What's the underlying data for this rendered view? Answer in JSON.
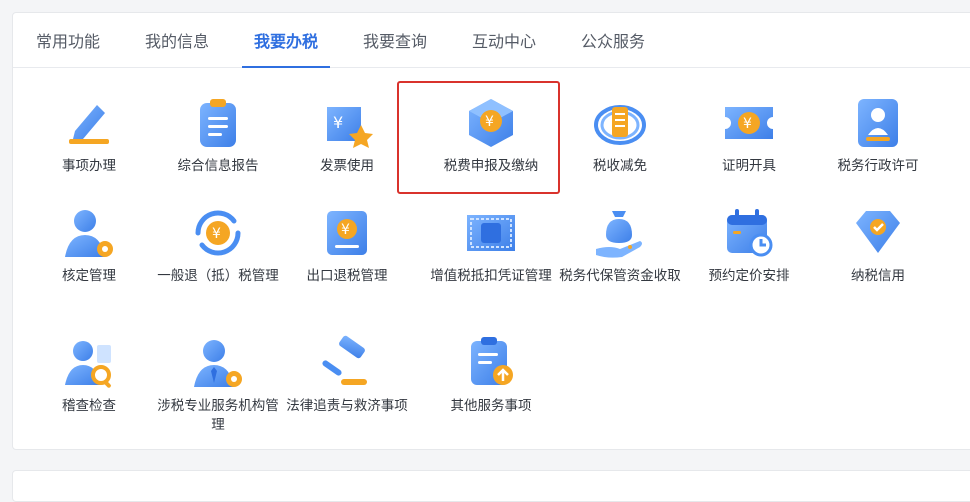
{
  "tabs": [
    {
      "label": "常用功能",
      "active": false
    },
    {
      "label": "我的信息",
      "active": false
    },
    {
      "label": "我要办税",
      "active": true
    },
    {
      "label": "我要查询",
      "active": false
    },
    {
      "label": "互动中心",
      "active": false
    },
    {
      "label": "公众服务",
      "active": false
    }
  ],
  "items": [
    {
      "label": "事项办理",
      "icon": "pencil-icon"
    },
    {
      "label": "综合信息报告",
      "icon": "clipboard-report-icon"
    },
    {
      "label": "发票使用",
      "icon": "invoice-star-icon"
    },
    {
      "label": "税费申报及缴纳",
      "icon": "yuan-cube-icon",
      "highlighted": true
    },
    {
      "label": "税收减免",
      "icon": "tax-emblem-icon"
    },
    {
      "label": "证明开具",
      "icon": "certificate-ticket-icon"
    },
    {
      "label": "税务行政许可",
      "icon": "stamp-license-icon"
    },
    {
      "label": "核定管理",
      "icon": "user-gear-icon"
    },
    {
      "label": "一般退（抵）税管理",
      "icon": "yuan-refresh-icon"
    },
    {
      "label": "出口退税管理",
      "icon": "yuan-book-icon"
    },
    {
      "label": "增值税抵扣凭证管理",
      "icon": "vat-ticket-icon"
    },
    {
      "label": "税务代保管资金收取",
      "icon": "money-bag-hand-icon"
    },
    {
      "label": "预约定价安排",
      "icon": "calendar-clock-icon"
    },
    {
      "label": "纳税信用",
      "icon": "heart-diamond-icon"
    },
    {
      "label": "稽查检查",
      "icon": "inspector-search-icon"
    },
    {
      "label": "涉税专业服务机构管理",
      "icon": "agent-gear-icon"
    },
    {
      "label": "法律追责与救济事项",
      "icon": "gavel-icon"
    },
    {
      "label": "其他服务事项",
      "icon": "list-upload-icon"
    }
  ],
  "colors": {
    "accent": "#2f6fe0",
    "iconBlue": "#4a8ef2",
    "iconOrange": "#f5a623",
    "highlight": "#d9322c"
  }
}
